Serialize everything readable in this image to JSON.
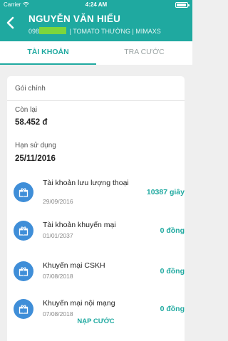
{
  "status_bar": {
    "carrier": "Carrier",
    "time": "4:24 AM"
  },
  "header": {
    "title": "NGUYỄN VĂN HIẾU",
    "phone_prefix": "098",
    "plan_info": " | TOMATO THƯỜNG | MIMAXS"
  },
  "tabs": [
    {
      "label": "TÀI KHOẢN",
      "active": true
    },
    {
      "label": "TRA CƯỚC",
      "active": false
    }
  ],
  "main_package": {
    "section_title": "Gói chính",
    "remaining_label": "Còn lại",
    "remaining_value": "58.452 đ",
    "expiry_label": "Hạn sử dụng",
    "expiry_value": "25/11/2016"
  },
  "accounts": [
    {
      "name": "Tài khoản lưu lượng thoại",
      "date": "29/09/2016",
      "amount": "10387 giây",
      "icon": "gift-icon"
    },
    {
      "name": "Tài khoản khuyến mại",
      "date": "01/01/2037",
      "amount": "0 đồng",
      "icon": "gift-icon"
    },
    {
      "name": "Khuyến mại CSKH",
      "date": "07/08/2018",
      "amount": "0 đồng",
      "icon": "gift-icon"
    },
    {
      "name": "Khuyến mại nội mạng",
      "date": "07/08/2018",
      "amount": "0 đồng",
      "icon": "gift-icon"
    }
  ],
  "topup_label": "NẠP CƯỚC",
  "colors": {
    "primary": "#1fa9a0",
    "icon_blue": "#3f8ed8",
    "background": "#efefef"
  }
}
